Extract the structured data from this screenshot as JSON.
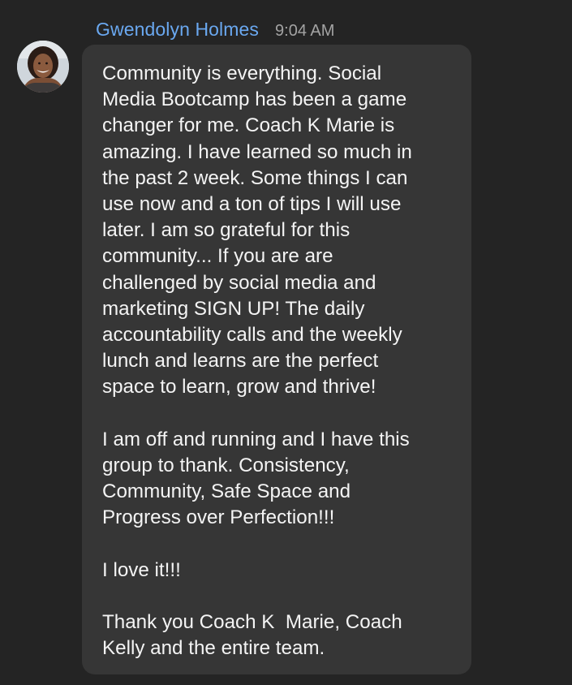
{
  "message": {
    "sender": "Gwendolyn Holmes",
    "timestamp": "9:04 AM",
    "avatar_icon": "profile-photo",
    "paragraphs": [
      "Community is everything. Social\nMedia Bootcamp has been a game\nchanger for me. Coach K Marie is\namazing. I have learned so much in\nthe past 2 week. Some things I can\nuse now and a ton of tips I will use\nlater. I am so grateful for this\ncommunity... If you are are\nchallenged by social media and\nmarketing SIGN UP! The daily\naccountability calls and the weekly\nlunch and learns are the perfect\nspace to learn, grow and thrive!",
      "I am off and running and I have this\ngroup to thank. Consistency,\nCommunity, Safe Space and\nProgress over Perfection!!!",
      "I love it!!!",
      "Thank you Coach K  Marie, Coach\nKelly and the entire team."
    ]
  },
  "colors": {
    "background": "#242424",
    "bubble": "#363636",
    "sender_name": "#6aa8f0",
    "timestamp": "#a3a3a3",
    "message_text": "#f4f4f4"
  }
}
